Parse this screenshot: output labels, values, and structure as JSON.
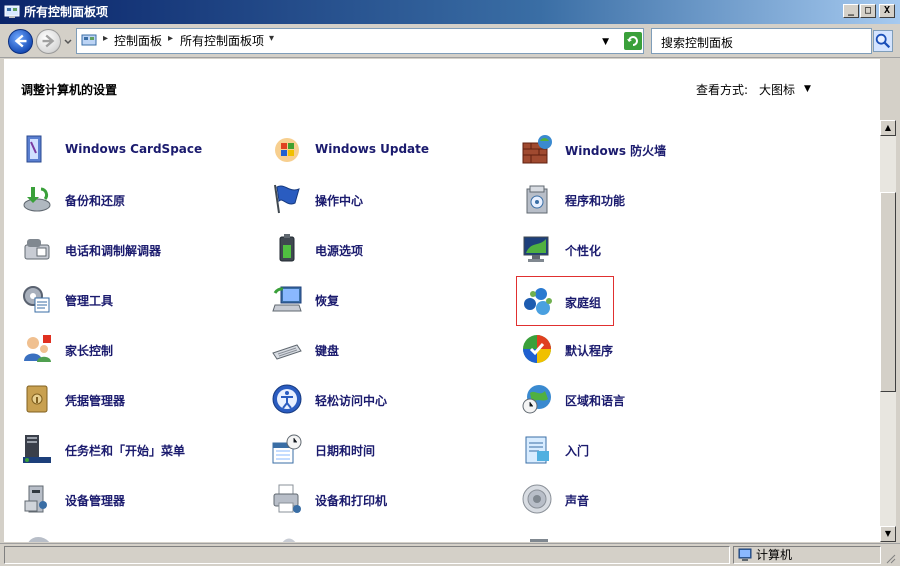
{
  "window": {
    "title": "所有控制面板项"
  },
  "titlebar_buttons": {
    "minimize": "_",
    "maximize": "□",
    "close": "X"
  },
  "address": {
    "crumbs": [
      "控制面板",
      "所有控制面板项"
    ],
    "search_placeholder": "搜索控制面板"
  },
  "header": {
    "title": "调整计算机的设置",
    "view_label": "查看方式:",
    "view_value": "大图标"
  },
  "items": [
    {
      "label": "Windows CardSpace",
      "icon": "cardspace-icon"
    },
    {
      "label": "Windows Update",
      "icon": "windows-update-icon"
    },
    {
      "label": "Windows 防火墙",
      "icon": "firewall-icon"
    },
    {
      "label": "备份和还原",
      "icon": "backup-icon"
    },
    {
      "label": "操作中心",
      "icon": "action-center-flag-icon"
    },
    {
      "label": "程序和功能",
      "icon": "programs-icon"
    },
    {
      "label": "电话和调制解调器",
      "icon": "phone-modem-icon"
    },
    {
      "label": "电源选项",
      "icon": "power-options-icon"
    },
    {
      "label": "个性化",
      "icon": "personalization-icon"
    },
    {
      "label": "管理工具",
      "icon": "admin-tools-icon"
    },
    {
      "label": "恢复",
      "icon": "recovery-icon"
    },
    {
      "label": "家庭组",
      "icon": "homegroup-icon"
    },
    {
      "label": "家长控制",
      "icon": "parental-controls-icon"
    },
    {
      "label": "键盘",
      "icon": "keyboard-icon"
    },
    {
      "label": "默认程序",
      "icon": "default-programs-icon"
    },
    {
      "label": "凭据管理器",
      "icon": "credential-manager-icon"
    },
    {
      "label": "轻松访问中心",
      "icon": "ease-of-access-icon"
    },
    {
      "label": "区域和语言",
      "icon": "region-language-icon"
    },
    {
      "label": "任务栏和「开始」菜单",
      "icon": "taskbar-icon"
    },
    {
      "label": "日期和时间",
      "icon": "date-time-icon"
    },
    {
      "label": "入门",
      "icon": "getting-started-icon"
    },
    {
      "label": "设备管理器",
      "icon": "device-manager-icon"
    },
    {
      "label": "设备和打印机",
      "icon": "devices-printers-icon"
    },
    {
      "label": "声音",
      "icon": "sound-icon"
    }
  ],
  "selected_item": "家庭组",
  "statusbar": {
    "location": "计算机"
  },
  "colors": {
    "label_text": "#1b1b6e",
    "selection_border": "#e03030",
    "titlebar_start": "#0a246a"
  }
}
